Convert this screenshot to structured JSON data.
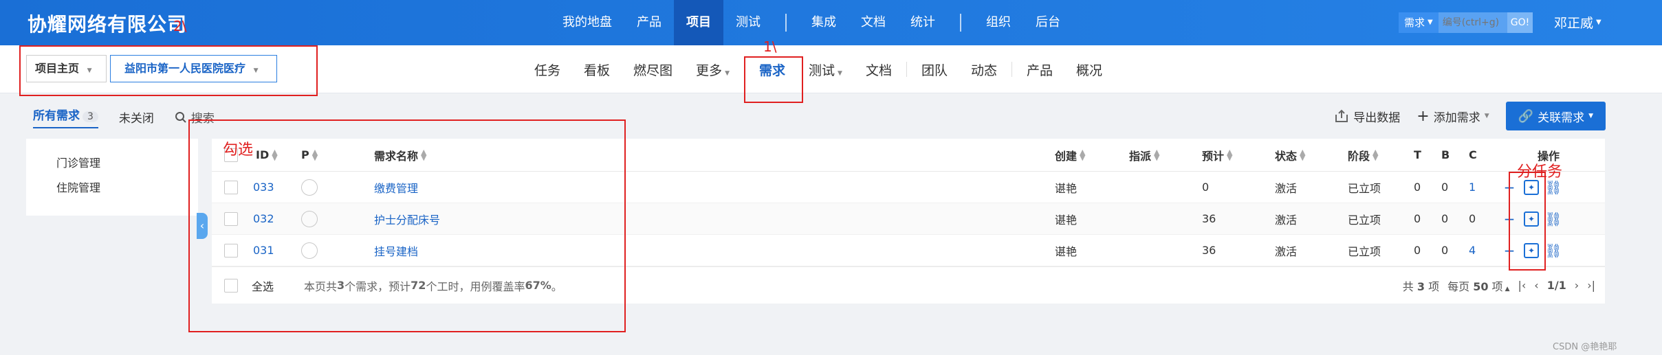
{
  "topbar": {
    "brand": "协耀网络有限公司",
    "nav": [
      "我的地盘",
      "产品",
      "项目",
      "测试",
      "集成",
      "文档",
      "统计",
      "组织",
      "后台"
    ],
    "active_nav": "项目",
    "search_type": "需求",
    "search_placeholder": "编号(ctrl+g)",
    "go_label": "GO!",
    "user": "邓正威"
  },
  "subbar": {
    "crumb_home": "项目主页",
    "crumb_project": "益阳市第一人民医院医疗",
    "nav": [
      "任务",
      "看板",
      "燃尽图",
      "更多",
      "需求",
      "测试",
      "文档",
      "团队",
      "动态",
      "产品",
      "概况"
    ],
    "active_nav": "需求"
  },
  "filters": {
    "all": "所有需求",
    "all_count": "3",
    "unclosed": "未关闭",
    "search": "搜索"
  },
  "actions": {
    "export": "导出数据",
    "add": "添加需求",
    "link": "关联需求"
  },
  "modules": [
    "门诊管理",
    "住院管理"
  ],
  "table": {
    "headers": {
      "id": "ID",
      "p": "P",
      "name": "需求名称",
      "creator": "创建",
      "assign": "指派",
      "estimate": "预计",
      "status": "状态",
      "stage": "阶段",
      "t": "T",
      "b": "B",
      "c": "C",
      "ops": "操作"
    },
    "rows": [
      {
        "id": "033",
        "name": "缴费管理",
        "creator": "谌艳",
        "estimate": "0",
        "status": "激活",
        "stage": "已立项",
        "t": "0",
        "b": "0",
        "c": "1"
      },
      {
        "id": "032",
        "name": "护士分配床号",
        "creator": "谌艳",
        "estimate": "36",
        "status": "激活",
        "stage": "已立项",
        "t": "0",
        "b": "0",
        "c": "0"
      },
      {
        "id": "031",
        "name": "挂号建档",
        "creator": "谌艳",
        "estimate": "36",
        "status": "激活",
        "stage": "已立项",
        "t": "0",
        "b": "0",
        "c": "4"
      }
    ],
    "footer": {
      "select_all": "全选",
      "summary_pre": "本页共 ",
      "summary_count": "3",
      "summary_mid1": " 个需求，预计 ",
      "summary_hours": "72",
      "summary_mid2": " 个工时，用例覆盖率 ",
      "summary_rate": "67%",
      "summary_post": "。",
      "total_pre": "共 ",
      "total_count": "3",
      "total_post": " 项",
      "per_page_pre": "每页 ",
      "per_page": "50",
      "per_page_post": " 项",
      "page": "1/1"
    }
  },
  "annotations": {
    "num2": "2\\",
    "num1": "1\\",
    "check": "勾选",
    "split": "分任务"
  },
  "watermark": "CSDN @艳艳耶",
  "colors": {
    "primary": "#1a6fd6",
    "annotation": "#e02020"
  }
}
